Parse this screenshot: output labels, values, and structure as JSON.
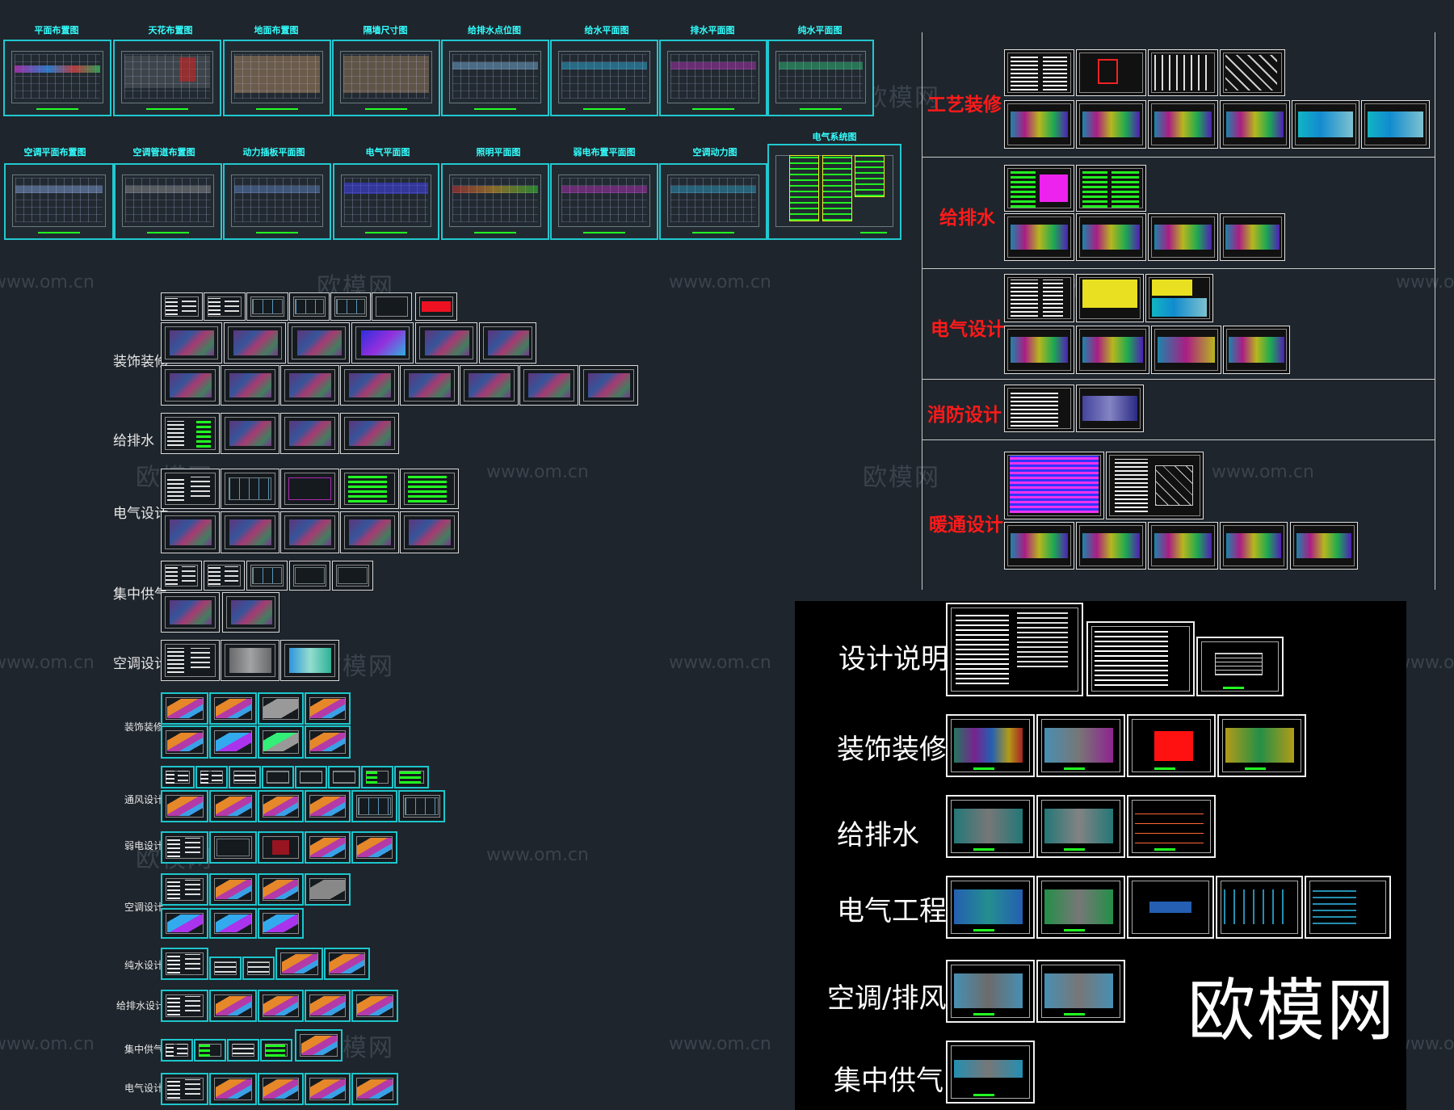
{
  "watermark": {
    "text_cn": "欧模网",
    "text_url": "www.om.cn"
  },
  "top_row_1": {
    "labels": [
      "平面布置图",
      "天花布置图",
      "地面布置图",
      "隔墙尺寸图",
      "给排水点位图",
      "给水平面图",
      "排水平面图",
      "纯水平面图"
    ]
  },
  "top_row_2": {
    "labels": [
      "空调平面布置图",
      "空调管道布置图",
      "动力插板平面图",
      "电气平面图",
      "照明平面图",
      "弱电布置平面图",
      "空调动力图",
      "电气系统图"
    ]
  },
  "left_groups": {
    "labels_large": [
      "装饰装修",
      "给排水",
      "电气设计",
      "集中供气",
      "空调设计"
    ],
    "labels_small": [
      "装饰装修",
      "通风设计",
      "弱电设计",
      "空调设计",
      "纯水设计",
      "给排水设计",
      "集中供气",
      "电气设计"
    ]
  },
  "right_panel": {
    "labels": [
      "工艺装修",
      "给排水",
      "电气设计",
      "消防设计",
      "暖通设计"
    ]
  },
  "black_panel": {
    "labels": [
      "设计说明",
      "装饰装修",
      "给排水",
      "电气工程",
      "空调/排风",
      "集中供气"
    ],
    "brand": "欧模网"
  },
  "colors": {
    "accent_cyan": "#22c8d0",
    "label_red": "#ff1a1a",
    "background": "#1e252c"
  }
}
